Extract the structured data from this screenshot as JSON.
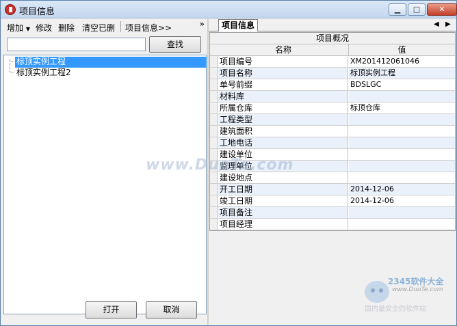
{
  "window": {
    "title": "项目信息",
    "min": "▁",
    "max": "□",
    "close": "✕"
  },
  "toolbar": {
    "add": "增加",
    "edit": "修改",
    "delete": "删除",
    "clear_deleted": "清空已删",
    "project_info": "项目信息>>",
    "more": "»"
  },
  "search": {
    "value": "",
    "button": "查找"
  },
  "tree": {
    "items": [
      {
        "label": "标顶实例工程",
        "selected": true
      },
      {
        "label": "标顶实例工程2",
        "selected": false
      }
    ]
  },
  "footer": {
    "open": "打开",
    "cancel": "取消"
  },
  "right": {
    "tab": "项目信息",
    "grid_title": "项目概况",
    "col_name": "名称",
    "col_value": "值",
    "rows": [
      {
        "name": "项目编号",
        "value": "XM201412061046"
      },
      {
        "name": "项目名称",
        "value": "标顶实例工程"
      },
      {
        "name": "单号前缀",
        "value": "BDSLGC"
      },
      {
        "name": "材料库",
        "value": ""
      },
      {
        "name": "所属仓库",
        "value": "标顶仓库"
      },
      {
        "name": "工程类型",
        "value": ""
      },
      {
        "name": "建筑面积",
        "value": ""
      },
      {
        "name": "工地电话",
        "value": ""
      },
      {
        "name": "建设单位",
        "value": ""
      },
      {
        "name": "监理单位",
        "value": ""
      },
      {
        "name": "建设地点",
        "value": ""
      },
      {
        "name": "开工日期",
        "value": "2014-12-06"
      },
      {
        "name": "竣工日期",
        "value": "2014-12-06"
      },
      {
        "name": "项目备注",
        "value": ""
      },
      {
        "name": "项目经理",
        "value": ""
      }
    ]
  },
  "watermark": {
    "text": "www.DuoTe.com",
    "logo_brand": "2345软件大全",
    "logo_url": "www.DuoTe.com",
    "logo_tagline": "国内最安全的软件站"
  },
  "colors": {
    "selection": "#3399ff",
    "row_alt": "#eaf1fb",
    "close_button": "#c4402a"
  }
}
